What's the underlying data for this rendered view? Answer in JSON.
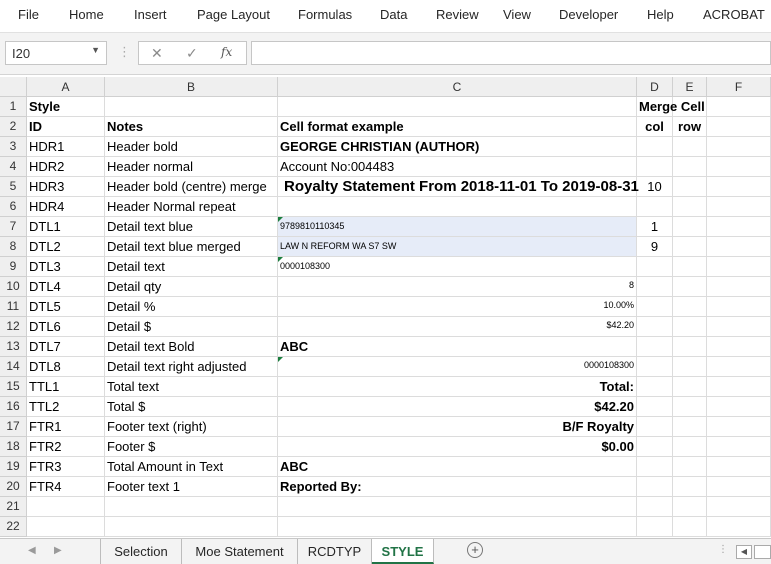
{
  "ribbon": {
    "tabs": [
      "File",
      "Home",
      "Insert",
      "Page Layout",
      "Formulas",
      "Data",
      "Review",
      "View",
      "Developer",
      "Help",
      "ACROBAT"
    ]
  },
  "formula_bar": {
    "name_box": "I20",
    "formula": ""
  },
  "columns": [
    "A",
    "B",
    "C",
    "D",
    "E",
    "F"
  ],
  "rows": [
    {
      "n": "1",
      "a": "Style",
      "b": "",
      "c": "",
      "d": "Merge Cell",
      "e": ""
    },
    {
      "n": "2",
      "a": "ID",
      "b": "Notes",
      "c": "Cell format example",
      "d": "col",
      "e": "row"
    },
    {
      "n": "3",
      "a": "HDR1",
      "b": "Header bold",
      "c": "GEORGE CHRISTIAN (AUTHOR)",
      "d": "",
      "e": ""
    },
    {
      "n": "4",
      "a": "HDR2",
      "b": "Header normal",
      "c": "Account No:004483",
      "d": "",
      "e": ""
    },
    {
      "n": "5",
      "a": "HDR3",
      "b": "Header bold (centre) merge",
      "c": "Royalty Statement From 2018-11-01 To 2019-08-31",
      "d": "10",
      "e": ""
    },
    {
      "n": "6",
      "a": "HDR4",
      "b": "Header Normal repeat",
      "c": "",
      "d": "",
      "e": ""
    },
    {
      "n": "7",
      "a": "DTL1",
      "b": "Detail text blue",
      "c": "9789810110345",
      "d": "1",
      "e": ""
    },
    {
      "n": "8",
      "a": "DTL2",
      "b": "Detail text blue merged",
      "c": "LAW N REFORM WA S7 SW",
      "d": "9",
      "e": ""
    },
    {
      "n": "9",
      "a": "DTL3",
      "b": "Detail text",
      "c": "0000108300",
      "d": "",
      "e": ""
    },
    {
      "n": "10",
      "a": "DTL4",
      "b": "Detail qty",
      "c": "8",
      "d": "",
      "e": ""
    },
    {
      "n": "11",
      "a": "DTL5",
      "b": "Detail %",
      "c": "10.00%",
      "d": "",
      "e": ""
    },
    {
      "n": "12",
      "a": "DTL6",
      "b": "Detail $",
      "c": "$42.20",
      "d": "",
      "e": ""
    },
    {
      "n": "13",
      "a": "DTL7",
      "b": "Detail text Bold",
      "c": "ABC",
      "d": "",
      "e": ""
    },
    {
      "n": "14",
      "a": "DTL8",
      "b": "Detail text right adjusted",
      "c": "0000108300",
      "d": "",
      "e": ""
    },
    {
      "n": "15",
      "a": "TTL1",
      "b": "Total text",
      "c": "Total:",
      "d": "",
      "e": ""
    },
    {
      "n": "16",
      "a": "TTL2",
      "b": "Total $",
      "c": "$42.20",
      "d": "",
      "e": ""
    },
    {
      "n": "17",
      "a": "FTR1",
      "b": "Footer text (right)",
      "c": "B/F Royalty",
      "d": "",
      "e": ""
    },
    {
      "n": "18",
      "a": "FTR2",
      "b": "Footer $",
      "c": "$0.00",
      "d": "",
      "e": ""
    },
    {
      "n": "19",
      "a": "FTR3",
      "b": "Total Amount in Text",
      "c": "ABC",
      "d": "",
      "e": ""
    },
    {
      "n": "20",
      "a": "FTR4",
      "b": "Footer text 1",
      "c": "Reported By:",
      "d": "",
      "e": ""
    },
    {
      "n": "21",
      "a": "",
      "b": "",
      "c": "",
      "d": "",
      "e": ""
    },
    {
      "n": "22",
      "a": "",
      "b": "",
      "c": "",
      "d": "",
      "e": ""
    }
  ],
  "sheets": [
    "Selection",
    "Moe Statement",
    "RCDTYP",
    "STYLE"
  ],
  "active_sheet": "STYLE"
}
